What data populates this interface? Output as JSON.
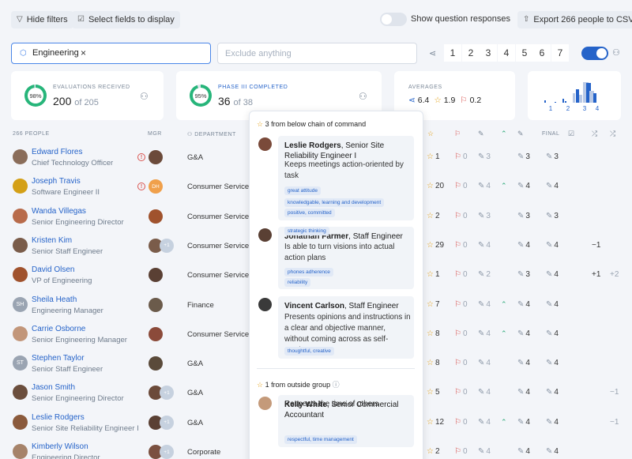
{
  "toolbar": {
    "hide_filters": "Hide filters",
    "select_fields": "Select fields to display",
    "show_responses": "Show question responses",
    "export": "Export 266 people to CSV"
  },
  "filter": {
    "chip": "Engineering",
    "chip_remove": "×",
    "exclude_placeholder": "Exclude anything"
  },
  "pagination": [
    "1",
    "2",
    "3",
    "4",
    "5",
    "6",
    "7"
  ],
  "cards": {
    "evaluations": {
      "pct": "98%",
      "pct_value": 0.98,
      "label": "Evaluations received",
      "value": "200",
      "of": "of 205"
    },
    "phase": {
      "pct": "95%",
      "pct_value": 0.95,
      "label": "Phase III completed",
      "value": "36",
      "of": "of 38"
    },
    "averages": {
      "label": "Averages",
      "a": "6.4",
      "b": "1.9",
      "c": "0.2"
    },
    "histogram": {
      "ticks": [
        "1",
        "2",
        "3",
        "4"
      ]
    }
  },
  "columns": {
    "people": "266 People",
    "mgr": "Mgr",
    "department": "Department",
    "final": "Final"
  },
  "rows": [
    {
      "name": "Edward Flores",
      "title": "Chief Technology Officer",
      "dept": "G&A",
      "stars": "1",
      "flags": "0",
      "p1": "3",
      "p2": "",
      "p3": "3",
      "p4": "3",
      "e1": "",
      "e2": ""
    },
    {
      "name": "Joseph Travis",
      "title": "Software Engineer II",
      "dept": "Consumer Services",
      "stars": "20",
      "flags": "0",
      "p1": "4",
      "p2": "^",
      "p3": "4",
      "p4": "4",
      "e1": "",
      "e2": "",
      "mgr_initials": "DH"
    },
    {
      "name": "Wanda Villegas",
      "title": "Senior Engineering Director",
      "dept": "Consumer Services",
      "stars": "2",
      "flags": "0",
      "p1": "3",
      "p2": "",
      "p3": "3",
      "p4": "3",
      "e1": "",
      "e2": ""
    },
    {
      "name": "Kristen Kim",
      "title": "Senior Staff Engineer",
      "dept": "Consumer Services",
      "stars": "29",
      "flags": "0",
      "p1": "4",
      "p2": "",
      "p3": "4",
      "p4": "4",
      "e1": "−1",
      "e2": "",
      "plus": "+1"
    },
    {
      "name": "David Olsen",
      "title": "VP of Engineering",
      "dept": "Consumer Services",
      "stars": "1",
      "flags": "0",
      "p1": "2",
      "p2": "",
      "p3": "3",
      "p4": "4",
      "e1": "+1",
      "e2": "+2"
    },
    {
      "name": "Sheila Heath",
      "title": "Engineering Manager",
      "dept": "Finance",
      "stars": "7",
      "flags": "0",
      "p1": "4",
      "p2": "^",
      "p3": "4",
      "p4": "4",
      "e1": "",
      "e2": "",
      "initials": "SH"
    },
    {
      "name": "Carrie Osborne",
      "title": "Senior Engineering Manager",
      "dept": "Consumer Services",
      "stars": "8",
      "flags": "0",
      "p1": "4",
      "p2": "^",
      "p3": "4",
      "p4": "4",
      "e1": "",
      "e2": ""
    },
    {
      "name": "Stephen Taylor",
      "title": "Senior Staff Engineer",
      "dept": "G&A",
      "stars": "8",
      "flags": "0",
      "p1": "4",
      "p2": "",
      "p3": "4",
      "p4": "4",
      "e1": "",
      "e2": "",
      "initials": "ST"
    },
    {
      "name": "Jason Smith",
      "title": "Senior Engineering Director",
      "dept": "G&A",
      "stars": "5",
      "flags": "0",
      "p1": "4",
      "p2": "",
      "p3": "4",
      "p4": "4",
      "e1": "",
      "e2": "−1",
      "plus": "+1"
    },
    {
      "name": "Leslie Rodgers",
      "title": "Senior Site Reliability Engineer I",
      "dept": "G&A",
      "stars": "12",
      "flags": "0",
      "p1": "4",
      "p2": "^",
      "p3": "4",
      "p4": "4",
      "e1": "",
      "e2": "−1",
      "plus": "+1"
    },
    {
      "name": "Kimberly Wilson",
      "title": "Engineering Director",
      "dept": "Corporate",
      "stars": "2",
      "flags": "0",
      "p1": "4",
      "p2": "",
      "p3": "4",
      "p4": "4",
      "e1": "",
      "e2": "",
      "plus": "+1"
    }
  ],
  "popup": {
    "chain_header": "3 from below chain of command",
    "outside_header": "1 from outside group",
    "items": [
      {
        "name": "Leslie Rodgers",
        "role": ", Senior Site Reliability Engineer I",
        "text": "Keeps meetings action-oriented by task",
        "tags": [
          "great attitude",
          "knowledgable, learning and development",
          "positive, committed"
        ]
      },
      {
        "name": "Jonathan Farmer",
        "role": ", Staff Engineer",
        "text": "Is able to turn visions into actual action plans",
        "tags": [
          "phones adherence",
          "reliability",
          "strategic thinking"
        ]
      },
      {
        "name": "Vincent Carlson",
        "role": ", Staff Engineer",
        "text": "Presents opinions and instructions in a clear and objective manner, without coming across as self-serving.",
        "tags": [
          "thoughtful, creative"
        ]
      },
      {
        "name": "Kelly White",
        "role": ", Senior Commercial Accountant",
        "text": "Respects the time of others",
        "tags": [
          "respectful, time management"
        ]
      }
    ]
  },
  "colors": {
    "accent": "#2563c9",
    "green": "#27b57a",
    "toggle_on": "#2563c9"
  }
}
